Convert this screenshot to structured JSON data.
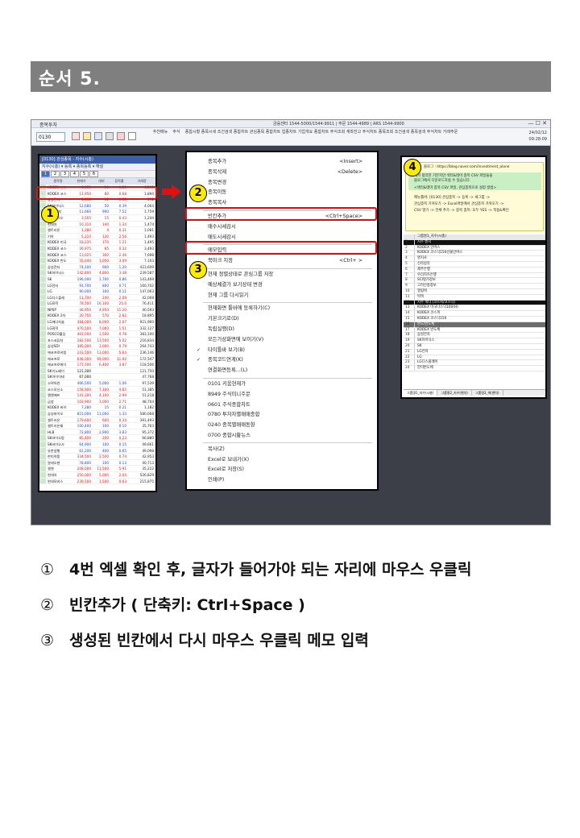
{
  "heading": "순서 5.",
  "app": {
    "name": "종목투자",
    "info": "금융센터 1544-5000/1544-9911 | 주문 1544-4989 | ARS 1544-9900",
    "win_controls": "— ☐ ✕",
    "code": "0130",
    "menu": [
      "추천메뉴",
      "주식",
      "종합시황",
      "종목시세",
      "조건검색",
      "종합차트",
      "관심종목",
      "종합차트",
      "업종차트",
      "기업개요",
      "종합차트",
      "주식조회",
      "계좌잔고",
      "주식차트",
      "종목조회",
      "조건검색",
      "종목검색",
      "주식차트",
      "거래주문"
    ],
    "datetime_line1": "24/02/12",
    "datetime_line2": "09:28:09"
  },
  "left_panel": {
    "title": "[0130] 관심종목 - 지수(시총)",
    "toolbar": "지수(시총) ▾ 등록 ▾ 종목등록 ▾ 해설",
    "tabs": [
      "1",
      "2",
      "3",
      "4",
      "5",
      "6"
    ],
    "active_tab": "1",
    "headers": [
      "",
      "종목명",
      "현재가",
      "대비",
      "등락률",
      "거래량"
    ],
    "rows": [
      {
        "name": "KODEX 인버",
        "price": "4,350",
        "dir": "dn",
        "change": "10",
        "rate": "0.23",
        "vol": "6,295"
      },
      {
        "name": "KODEX 코스",
        "price": "11,950",
        "dir": "up",
        "change": "80",
        "rate": "0.68",
        "vol": "1,894"
      },
      {
        "name": "삼성전자",
        "price": "1,636",
        "dir": "up",
        "change": "11",
        "rate": "0.68",
        "vol": "392"
      },
      {
        "name": "SK하이닉스",
        "price": "12,680",
        "dir": "dn",
        "change": "50",
        "rate": "0.39",
        "vol": "4,064"
      },
      {
        "name": "LG에너지",
        "price": "11,660",
        "dir": "dn",
        "change": "900",
        "rate": "7.52",
        "vol": "1,759"
      },
      {
        "name": "삼성바이오",
        "price": "3,505",
        "dir": "up",
        "change": "15",
        "rate": "0.43",
        "vol": "1,244"
      },
      {
        "name": "현대차",
        "price": "10,310",
        "dir": "up",
        "change": "140",
        "rate": "1.34",
        "vol": "1,474"
      },
      {
        "name": "셀트리온",
        "price": "1,280",
        "dir": "up",
        "change": "4",
        "rate": "0.31",
        "vol": "1,081"
      },
      {
        "name": "기아",
        "price": "5,210",
        "dir": "up",
        "change": "130",
        "rate": "2.56",
        "vol": "1,493"
      },
      {
        "name": "KODEX 미국",
        "price": "18,235",
        "dir": "up",
        "change": "170",
        "rate": "1.21",
        "vol": "1,495"
      },
      {
        "name": "KODEX 코스",
        "price": "26,975",
        "dir": "up",
        "change": "85",
        "rate": "0.32",
        "vol": "3,493"
      },
      {
        "name": "KODEX 코스",
        "price": "13,025",
        "dir": "up",
        "change": "300",
        "rate": "2.36",
        "vol": "7,698"
      },
      {
        "name": "KODEX 반도",
        "price": "35,040",
        "dir": "up",
        "change": "1,050",
        "rate": "3.09",
        "vol": "7,103"
      },
      {
        "name": "삼성전자",
        "price": "74,100",
        "dir": "dn",
        "change": "900",
        "rate": "1.20",
        "vol": "423,609"
      },
      {
        "name": "SK하이닉스",
        "price": "142,800",
        "dir": "up",
        "change": "4,800",
        "rate": "3.48",
        "vol": "239,587"
      },
      {
        "name": "SK",
        "price": "196,000",
        "dir": "dn",
        "change": "1,700",
        "rate": "0.86",
        "vol": "143,469"
      },
      {
        "name": "LG전자",
        "price": "91,700",
        "dir": "dn",
        "change": "800",
        "rate": "0.71",
        "vol": "160,702"
      },
      {
        "name": "LG",
        "price": "90,000",
        "dir": "dn",
        "change": "100",
        "rate": "0.11",
        "vol": "147,063"
      },
      {
        "name": "LG디스플레",
        "price": "11,700",
        "dir": "up",
        "change": "240",
        "rate": "2.09",
        "vol": "42,008"
      },
      {
        "name": "LG화학",
        "price": "78,500",
        "dir": "up",
        "change": "16,100",
        "rate": "25.0",
        "vol": "76,411"
      },
      {
        "name": "NPSP",
        "price": "46,950",
        "dir": "up",
        "change": "4,950",
        "rate": "11.20",
        "vol": "40,593"
      },
      {
        "name": "KODEX 2차",
        "price": "20,755",
        "dir": "up",
        "change": "570",
        "rate": "2.82",
        "vol": "18,895"
      },
      {
        "name": "LG에너지솔",
        "price": "384,000",
        "dir": "up",
        "change": "8,000",
        "rate": "2.07",
        "vol": "921,960"
      },
      {
        "name": "LG화학",
        "price": "470,500",
        "dir": "up",
        "change": "7,000",
        "rate": "1.51",
        "vol": "332,127"
      },
      {
        "name": "POSCO홀딩",
        "price": "403,000",
        "dir": "up",
        "change": "3,500",
        "rate": "0.78",
        "vol": "383,100"
      },
      {
        "name": "포스코퓨처",
        "price": "282,500",
        "dir": "up",
        "change": "13,500",
        "rate": "5.02",
        "vol": "216,834"
      },
      {
        "name": "삼성SDI",
        "price": "385,000",
        "dir": "up",
        "change": "3,000",
        "rate": "0.79",
        "vol": "264,743"
      },
      {
        "name": "에코프로비엠",
        "price": "243,500",
        "dir": "up",
        "change": "13,000",
        "rate": "5.64",
        "vol": "236,146"
      },
      {
        "name": "에코프로",
        "price": "648,000",
        "dir": "up",
        "change": "69,000",
        "rate": "11.92",
        "vol": "172,547"
      },
      {
        "name": "에코프로에이",
        "price": "171,500",
        "dir": "up",
        "change": "6,400",
        "rate": "3.87",
        "vol": "118,506"
      },
      {
        "name": "SK이노베이",
        "price": "121,300",
        "dir": "",
        "change": "",
        "rate": "",
        "vol": "121,750"
      },
      {
        "name": "SK아이이테",
        "price": "67,000",
        "dir": "",
        "change": "",
        "rate": "",
        "vol": "47,768"
      },
      {
        "name": "고려아연",
        "price": "466,500",
        "dir": "dn",
        "change": "5,000",
        "rate": "1.06",
        "vol": "97,539"
      },
      {
        "name": "코스모신소",
        "price": "158,900",
        "dir": "up",
        "change": "7,100",
        "rate": "4.65",
        "vol": "51,385"
      },
      {
        "name": "엘앤에프",
        "price": "141,300",
        "dir": "up",
        "change": "4,100",
        "rate": "2.99",
        "vol": "51,218"
      },
      {
        "name": "금양",
        "price": "103,900",
        "dir": "up",
        "change": "3,000",
        "rate": "2.71",
        "vol": "48,704"
      },
      {
        "name": "KODEX 바이",
        "price": "7,280",
        "dir": "dn",
        "change": "15",
        "rate": "0.21",
        "vol": "1,182"
      },
      {
        "name": "삼성바이오",
        "price": "815,000",
        "dir": "dn",
        "change": "11,000",
        "rate": "1.33",
        "vol": "580,068"
      },
      {
        "name": "셀트리온",
        "price": "179,600",
        "dir": "up",
        "change": "600",
        "rate": "0.34",
        "vol": "391,493"
      },
      {
        "name": "셀트리온제",
        "price": "100,400",
        "dir": "dn",
        "change": "100",
        "rate": "0.10",
        "vol": "35,763"
      },
      {
        "name": "HLB",
        "price": "72,800",
        "dir": "dn",
        "change": "2,900",
        "rate": "3.83",
        "vol": "95,372"
      },
      {
        "name": "SK바이오팜",
        "price": "85,400",
        "dir": "up",
        "change": "200",
        "rate": "0.23",
        "vol": "66,880"
      },
      {
        "name": "SK바이오사",
        "price": "64,900",
        "dir": "dn",
        "change": "100",
        "rate": "0.15",
        "vol": "49,661"
      },
      {
        "name": "유한양행",
        "price": "61,200",
        "dir": "dn",
        "change": "400",
        "rate": "0.65",
        "vol": "49,098"
      },
      {
        "name": "한미약품",
        "price": "334,500",
        "dir": "up",
        "change": "2,500",
        "rate": "0.74",
        "vol": "42,953"
      },
      {
        "name": "알테오젠",
        "price": "78,800",
        "dir": "dn",
        "change": "100",
        "rate": "0.13",
        "vol": "40,713"
      },
      {
        "name": "셀젠",
        "price": "208,000",
        "dir": "up",
        "change": "11,500",
        "rate": "5.91",
        "vol": "35,222"
      },
      {
        "name": "현대차",
        "price": "250,000",
        "dir": "up",
        "change": "5,000",
        "rate": "2.04",
        "vol": "526,829"
      },
      {
        "name": "현대모비스",
        "price": "239,500",
        "dir": "up",
        "change": "1,500",
        "rate": "0.63",
        "vol": "215,875"
      }
    ]
  },
  "context_menu": {
    "items": [
      {
        "label": "종목추가",
        "shortcut": "<Insert>",
        "check": ""
      },
      {
        "label": "종목삭제",
        "shortcut": "<Delete>",
        "check": ""
      },
      {
        "label": "종목변경",
        "shortcut": "",
        "check": ""
      },
      {
        "label": "종목이동",
        "shortcut": "",
        "check": ""
      },
      {
        "label": "종목복사",
        "shortcut": "",
        "check": ""
      },
      {
        "label": "빈칸추가",
        "shortcut": "<Ctrl+Space>",
        "check": ""
      },
      {
        "label": "매수시세감시",
        "shortcut": "",
        "check": ""
      },
      {
        "label": "매도시세감시",
        "shortcut": "",
        "check": ""
      },
      {
        "label": "메모입력",
        "shortcut": "",
        "check": ""
      },
      {
        "label": "북마크 지정",
        "shortcut": "<Ctrl+ >",
        "check": ""
      },
      {
        "label": "현재 정렬상태로 관심그룹 저장",
        "shortcut": "",
        "check": ""
      },
      {
        "label": "예상체결가 보기상태 변경",
        "shortcut": "",
        "check": ""
      },
      {
        "label": "현재 그룹 다시읽기",
        "shortcut": "",
        "check": ""
      },
      {
        "label": "현재화면 툴바에 등록하기(C)",
        "shortcut": "",
        "check": ""
      },
      {
        "label": "기본크기로(D)",
        "shortcut": "",
        "check": ""
      },
      {
        "label": "독립실행(D)",
        "shortcut": "",
        "check": ""
      },
      {
        "label": "모든가상화면에 보이기(V)",
        "shortcut": "",
        "check": ""
      },
      {
        "label": "타이틀바 보기(B)",
        "shortcut": "",
        "check": "✓"
      },
      {
        "label": "종목코드연계(K)",
        "shortcut": "",
        "check": "✓"
      },
      {
        "label": "연결화면등록...(L)",
        "shortcut": "",
        "check": ""
      },
      {
        "label": "0101 키움현재가",
        "shortcut": "",
        "check": ""
      },
      {
        "label": "8949 주식미니주문",
        "shortcut": "",
        "check": ""
      },
      {
        "label": "0601 주식종합차트",
        "shortcut": "",
        "check": ""
      },
      {
        "label": "0780 투자자별매매종합",
        "shortcut": "",
        "check": ""
      },
      {
        "label": "0240 종목별매매동향",
        "shortcut": "",
        "check": ""
      },
      {
        "label": "0700 종합시황뉴스",
        "shortcut": "",
        "check": ""
      },
      {
        "label": "복사(Z)",
        "shortcut": "",
        "check": ""
      },
      {
        "label": "Excel로 보내기(X)",
        "shortcut": "",
        "check": ""
      },
      {
        "label": "Excel로 저장(S)",
        "shortcut": "",
        "check": ""
      },
      {
        "label": "인쇄(P)",
        "shortcut": "",
        "check": ""
      }
    ]
  },
  "right_panel": {
    "notice": [
      "블로그 : https://blog.naver.com/investment_alone",
      "제가 정리한 기본지만 섹터&테마 종목 CSV 파일들을",
      "블로그에서 다운로드하실 수 있습니다.",
      "<섹터&테마 종목 CSV 파일, 관심종목으로 설정 방법>",
      "메뉴툴바: [0130] 관심종목 -> 등록 -> 세그룹 ->",
      "관심종목 가져오기 -> Excel파일에서 관심종목 가져오기 ->",
      "CSV 열기 -> 전체 추가 -> 중복 종목: 모두 YES -> 적용&확인"
    ],
    "rows": [
      {
        "n": "",
        "v": "그룹명1_지수(시총)",
        "style": "head"
      },
      {
        "n": "1",
        "v": "지수 벤치",
        "style": "black"
      },
      {
        "n": "2",
        "v": "KODEX 인버스",
        "style": ""
      },
      {
        "n": "3",
        "v": "KODEX 코스닥150선물인버스",
        "style": ""
      },
      {
        "n": "4",
        "v": "명지사",
        "style": ""
      },
      {
        "n": "5",
        "v": "신라섬유",
        "style": ""
      },
      {
        "n": "6",
        "v": "제주은행",
        "style": ""
      },
      {
        "n": "7",
        "v": "우리치즈은행",
        "style": ""
      },
      {
        "n": "8",
        "v": "SCI평가정보",
        "style": ""
      },
      {
        "n": "9",
        "v": "고려신용정보",
        "style": ""
      },
      {
        "n": "10",
        "v": "열림텍",
        "style": ""
      },
      {
        "n": "11",
        "v": "빅텍",
        "style": ""
      },
      {
        "n": "12",
        "v": "지수 섹터 (코스피/코스닥)",
        "style": "black"
      },
      {
        "n": "13",
        "v": "KODEX 미국나스닥100(H)",
        "style": ""
      },
      {
        "n": "14",
        "v": "KODEX 코스피",
        "style": ""
      },
      {
        "n": "15",
        "v": "KODEX 코스닥150",
        "style": ""
      },
      {
        "n": "16",
        "v": "반도/반도체",
        "style": "gray"
      },
      {
        "n": "17",
        "v": "KODEX 반도체",
        "style": ""
      },
      {
        "n": "18",
        "v": "삼성전자",
        "style": ""
      },
      {
        "n": "19",
        "v": "SK하이닉스",
        "style": ""
      },
      {
        "n": "20",
        "v": "SK",
        "style": ""
      },
      {
        "n": "21",
        "v": "LG전자",
        "style": ""
      },
      {
        "n": "22",
        "v": "LG",
        "style": ""
      },
      {
        "n": "23",
        "v": "LG디스플레이",
        "style": ""
      },
      {
        "n": "24",
        "v": "한미반도체",
        "style": ""
      }
    ],
    "tabs": [
      "그룹명1_지수(시총)",
      "그룹명2_지수(벤치)",
      "그룹명3_섹(벤치)"
    ]
  },
  "badges": [
    "1",
    "2",
    "3",
    "4"
  ],
  "steps": [
    {
      "marker": "①",
      "text": "4번 엑셀 확인 후, 글자가 들어가야 되는 자리에 마우스 우클릭"
    },
    {
      "marker": "②",
      "text": "빈칸추가 ( 단축키: Ctrl+Space )"
    },
    {
      "marker": "③",
      "text": "생성된 빈칸에서 다시 마우스 우클릭 메모 입력"
    }
  ],
  "colors": {
    "highlight_red": "#e01010",
    "badge_yellow": "#ffeb00",
    "title_gray": "#7f7f7f",
    "price_up": "#d11111",
    "price_down": "#1a40d0"
  }
}
